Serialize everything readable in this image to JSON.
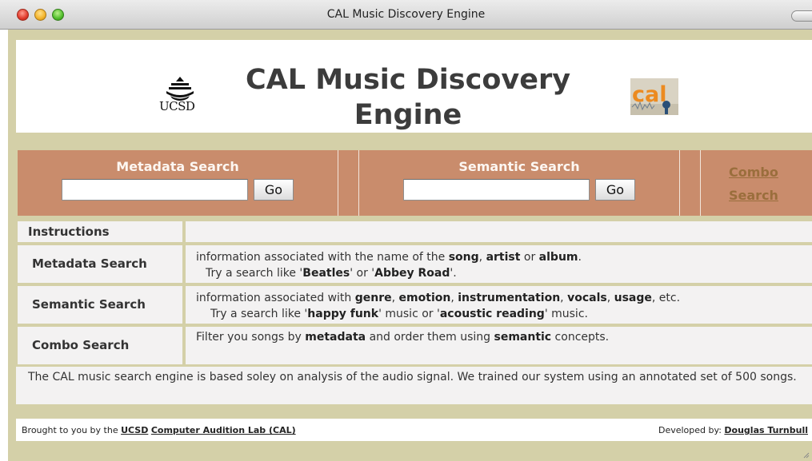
{
  "window": {
    "title": "CAL Music Discovery Engine"
  },
  "header": {
    "title_line1": "CAL Music Discovery",
    "title_line2": "Engine",
    "ucsd_logo_text": "UCSD",
    "cal_logo_text": "cal"
  },
  "search": {
    "metadata_label": "Metadata Search",
    "metadata_value": "",
    "metadata_go": "Go",
    "semantic_label": "Semantic Search",
    "semantic_value": "",
    "semantic_go": "Go",
    "combo_line1": "Combo",
    "combo_line2": "Search"
  },
  "instructions": {
    "heading": "Instructions",
    "rows": [
      {
        "label": "Metadata Search",
        "line1": [
          "information associated with the name of the ",
          "song",
          ", ",
          "artist",
          " or ",
          "album",
          "."
        ],
        "line2": [
          "Try a search like '",
          "Beatles",
          "' or '",
          "Abbey Road",
          "'."
        ]
      },
      {
        "label": "Semantic Search",
        "line1": [
          "information associated with ",
          "genre",
          ", ",
          "emotion",
          ", ",
          "instrumentation",
          ", ",
          "vocals",
          ", ",
          "usage",
          ", etc."
        ],
        "line2": [
          "Try a search like '",
          "happy funk",
          "' music or '",
          "acoustic reading",
          "' music."
        ]
      },
      {
        "label": "Combo Search",
        "line1": [
          "Filter you songs by ",
          "metadata",
          " and order them using ",
          "semantic",
          " concepts."
        ]
      }
    ],
    "note": "The CAL music search engine is based soley on analysis of the audio signal. We trained our system using an annotated set of 500 songs."
  },
  "footer": {
    "brought_prefix": "Brought to you by the ",
    "ucsd_link": "UCSD",
    "lab_link": "Computer Audition Lab (CAL)",
    "developed_prefix": "Developed by: ",
    "developer_link": "Douglas Turnbull"
  },
  "colors": {
    "frame_bg": "#d4d0a8",
    "search_bar_bg": "#c98c6c",
    "cell_bg": "#f3f2f2",
    "combo_link": "#9a6e3c"
  }
}
